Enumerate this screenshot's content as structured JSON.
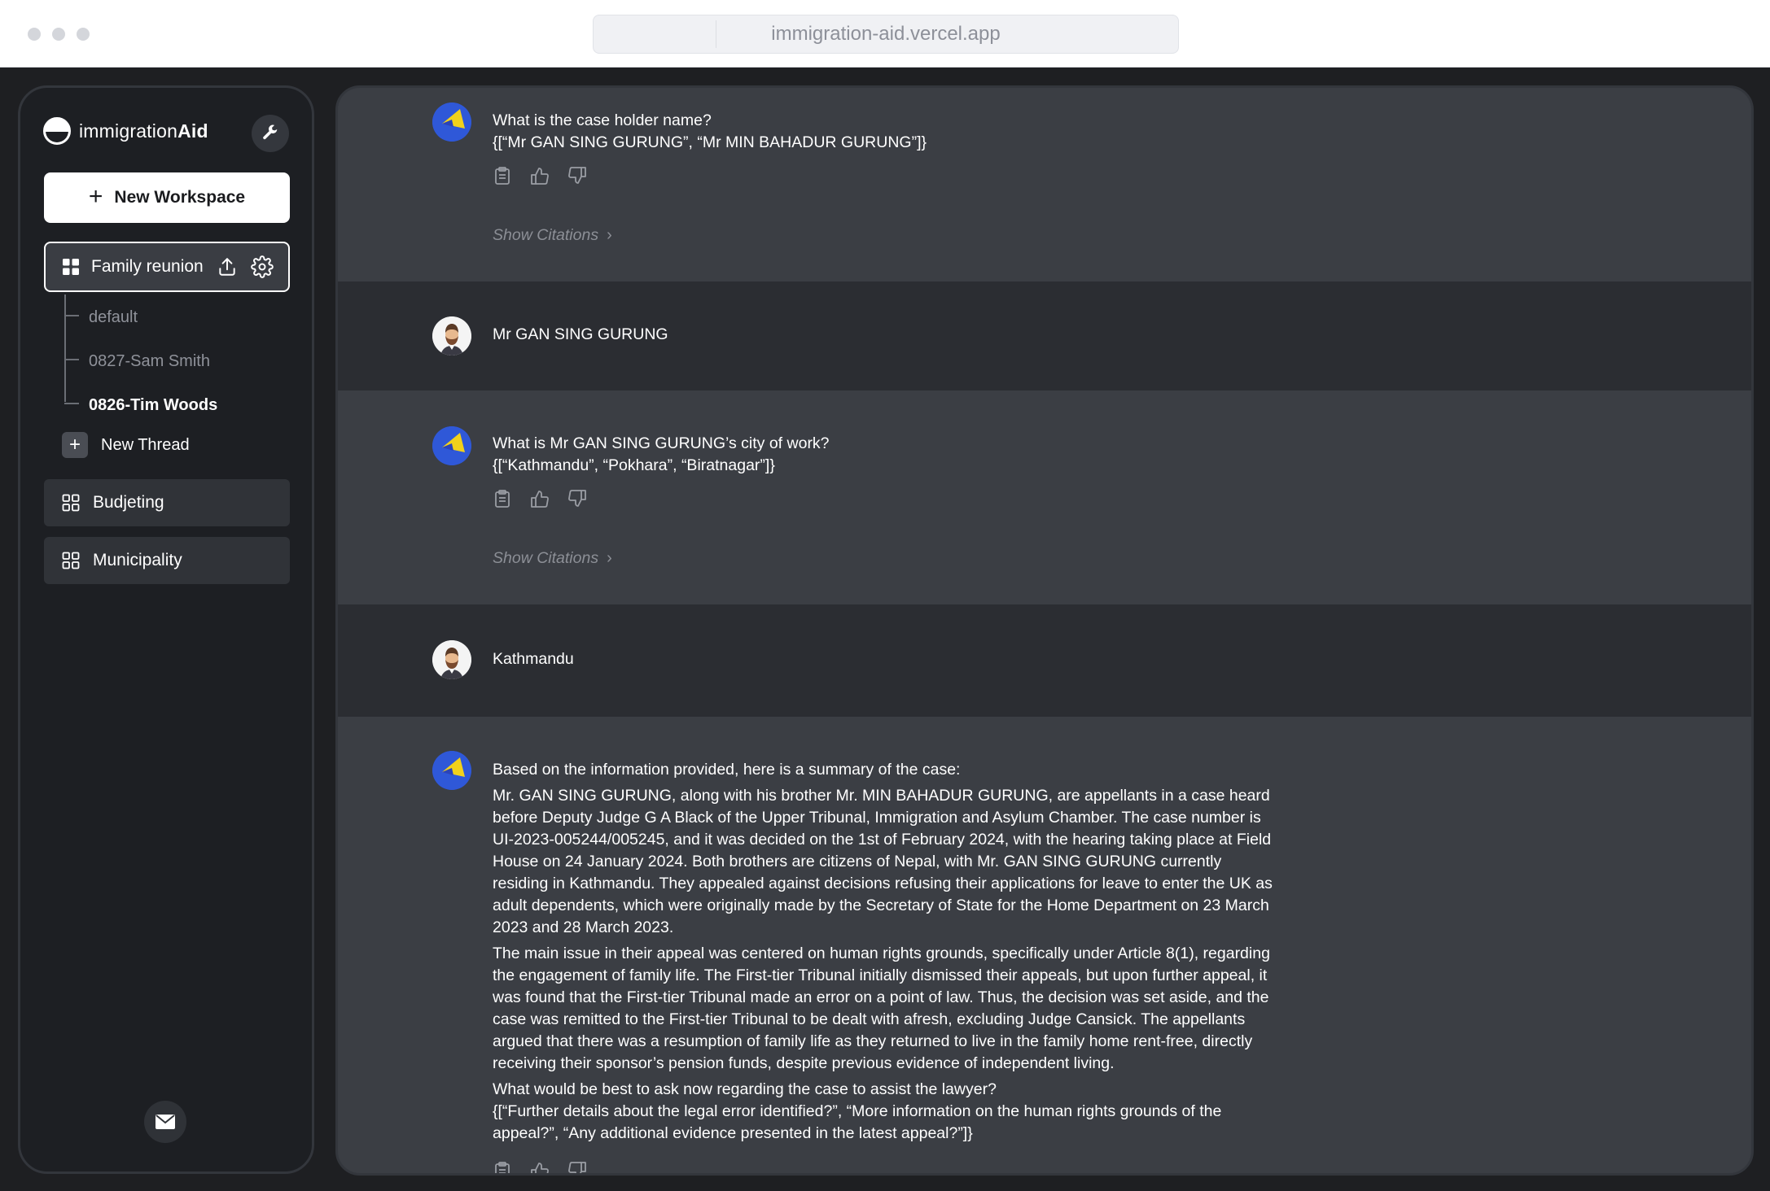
{
  "browser": {
    "url": "immigration-aid.vercel.app"
  },
  "sidebar": {
    "brand_prefix": "immigration",
    "brand_suffix": "Aid",
    "new_workspace_label": "New Workspace",
    "active_workspace": {
      "label": "Family reunion",
      "threads": [
        {
          "label": "default",
          "active": false
        },
        {
          "label": "0827-Sam Smith",
          "active": false
        },
        {
          "label": "0826-Tim Woods",
          "active": true
        }
      ]
    },
    "new_thread_label": "New Thread",
    "workspaces": [
      {
        "label": "Budjeting"
      },
      {
        "label": "Municipality"
      }
    ]
  },
  "chat": {
    "messages": [
      {
        "role": "assistant",
        "lines": [
          "What is the case holder name?",
          "{[“Mr GAN SING GURUNG”, “Mr MIN BAHADUR GURUNG”]}"
        ],
        "citations_label": "Show Citations"
      },
      {
        "role": "user",
        "text": "Mr GAN SING GURUNG"
      },
      {
        "role": "assistant",
        "lines": [
          "What is Mr GAN SING GURUNG’s city of work?",
          "{[“Kathmandu”, “Pokhara”, “Biratnagar”]}"
        ],
        "citations_label": "Show Citations"
      },
      {
        "role": "user",
        "text": "Kathmandu"
      },
      {
        "role": "assistant",
        "intro": "Based on the information provided, here is a summary of the case:",
        "paragraph1": "Mr. GAN SING GURUNG, along with his brother Mr. MIN BAHADUR GURUNG, are appellants in a case heard before Deputy Judge G A Black of the Upper Tribunal, Immigration and Asylum Chamber. The case number is UI-2023-005244/005245, and it was decided on the 1st of February 2024, with the hearing taking place at Field House on 24 January 2024. Both brothers are citizens of Nepal, with Mr. GAN SING GURUNG currently residing in Kathmandu. They appealed against decisions refusing their applications for leave to enter the UK as adult dependents, which were originally made by the Secretary of State for the Home Department on 23 March 2023 and 28 March 2023.",
        "paragraph2": "The main issue in their appeal was centered on human rights grounds, specifically under Article 8(1), regarding the engagement of family life. The First-tier Tribunal initially dismissed their appeals, but upon further appeal, it was found that the First-tier Tribunal made an error on a point of law. Thus, the decision was set aside, and the case was remitted to the First-tier Tribunal to be dealt with afresh, excluding Judge Cansick. The appellants argued that there was a resumption of family life as they returned to live in the family home rent-free, directly receiving their sponsor’s pension funds, despite previous evidence of independent living.",
        "question": "What would be best to ask now regarding the case to assist the lawyer?",
        "options": "{[“Further details about the legal error identified?”, “More information on the human rights grounds of the appeal?”, “Any additional evidence presented in the latest appeal?”]}"
      }
    ]
  },
  "icons": {
    "copy": "clipboard-icon",
    "like": "thumbs-up-icon",
    "dislike": "thumbs-down-icon",
    "settings": "wrench-icon",
    "upload": "upload-icon",
    "gear": "gear-icon",
    "grid": "grid-icon",
    "mail": "mail-icon"
  },
  "colors": {
    "sidebar_bg": "#1d1f23",
    "main_bg": "#3b3e44",
    "user_row_bg": "#2b2d32",
    "bot_avatar_blue": "#2f58d8",
    "bot_avatar_yellow": "#f2d11b"
  }
}
